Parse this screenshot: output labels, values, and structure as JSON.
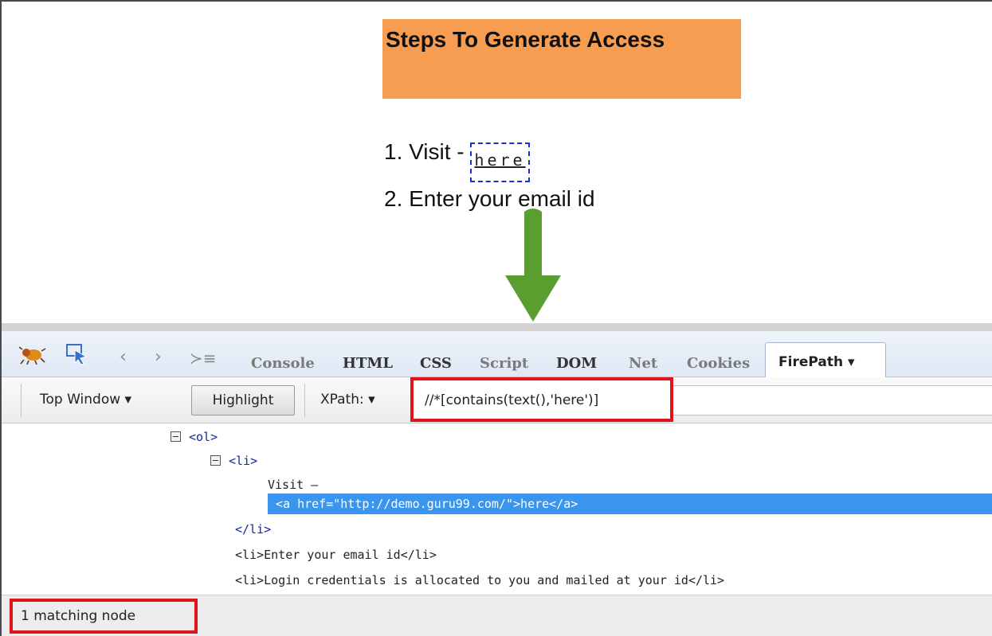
{
  "page": {
    "banner_title": "Steps To Generate Access",
    "step1_prefix": "1. Visit -",
    "step1_link": "here",
    "step2": "2. Enter your email id"
  },
  "devtools": {
    "tabs": [
      "Console",
      "HTML",
      "CSS",
      "Script",
      "DOM",
      "Net",
      "Cookies"
    ],
    "active_tab": "FirePath ▾",
    "toolbar": {
      "top_window": "Top Window ▾",
      "highlight": "Highlight",
      "xpath_label": "XPath: ▾",
      "xpath_value": "//*[contains(text(),'here')]"
    },
    "tree": {
      "ol_open": "<ol>",
      "li_open": "<li>",
      "visit_text": "Visit –",
      "anchor": "<a href=\"http://demo.guru99.com/\">here</a>",
      "li_close": "</li>",
      "li_email": "<li>Enter your email id</li>",
      "li_login": "<li>Login credentials is allocated to you and mailed at your id</li>"
    },
    "status": "1 matching node"
  },
  "colors": {
    "banner": "#f79d52",
    "highlight_box": "#e0141a",
    "selected_row": "#3a95ef",
    "arrow": "#5a9e2f"
  }
}
